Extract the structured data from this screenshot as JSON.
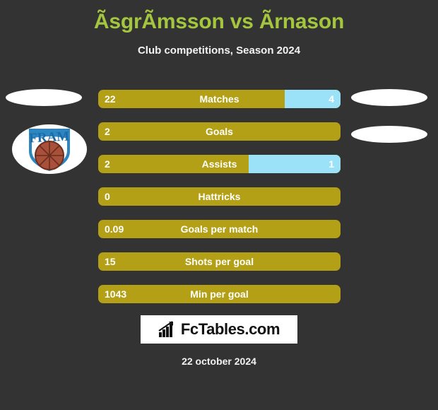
{
  "header": {
    "title": "ÃsgrÃ­msson vs Ãrnason",
    "subtitle": "Club competitions, Season 2024"
  },
  "footer": {
    "logo_text": "FcTables.com",
    "logo_icon": "bar-chart-icon",
    "date": "22 october 2024"
  },
  "crest": {
    "icon": "fram-club-crest-icon",
    "club_text": "FRAM"
  },
  "colors": {
    "background": "#333333",
    "title": "#A4C63F",
    "bar_left": "#B4A017",
    "bar_right": "#9BE2F8",
    "text": "#FFFFFF"
  },
  "chart_data": {
    "type": "bar",
    "title": "ÃsgrÃ­msson vs Ãrnason",
    "subtitle": "Club competitions, Season 2024",
    "orientation": "horizontal-diverging",
    "series": [
      {
        "name": "ÃsgrÃ­msson",
        "color": "#B4A017",
        "side": "left"
      },
      {
        "name": "Ãrnason",
        "color": "#9BE2F8",
        "side": "right"
      }
    ],
    "categories": [
      "Matches",
      "Goals",
      "Assists",
      "Hattricks",
      "Goals per match",
      "Shots per goal",
      "Min per goal"
    ],
    "rows": [
      {
        "label": "Matches",
        "left": "22",
        "right": "4",
        "left_pct": 77,
        "right_pct": 23
      },
      {
        "label": "Goals",
        "left": "2",
        "right": "",
        "left_pct": 100,
        "right_pct": 0
      },
      {
        "label": "Assists",
        "left": "2",
        "right": "1",
        "left_pct": 62,
        "right_pct": 38
      },
      {
        "label": "Hattricks",
        "left": "0",
        "right": "",
        "left_pct": 100,
        "right_pct": 0
      },
      {
        "label": "Goals per match",
        "left": "0.09",
        "right": "",
        "left_pct": 100,
        "right_pct": 0
      },
      {
        "label": "Shots per goal",
        "left": "15",
        "right": "",
        "left_pct": 100,
        "right_pct": 0
      },
      {
        "label": "Min per goal",
        "left": "1043",
        "right": "",
        "left_pct": 100,
        "right_pct": 0
      }
    ],
    "xlabel": "",
    "ylabel": "",
    "grid": false,
    "legend": "none"
  }
}
